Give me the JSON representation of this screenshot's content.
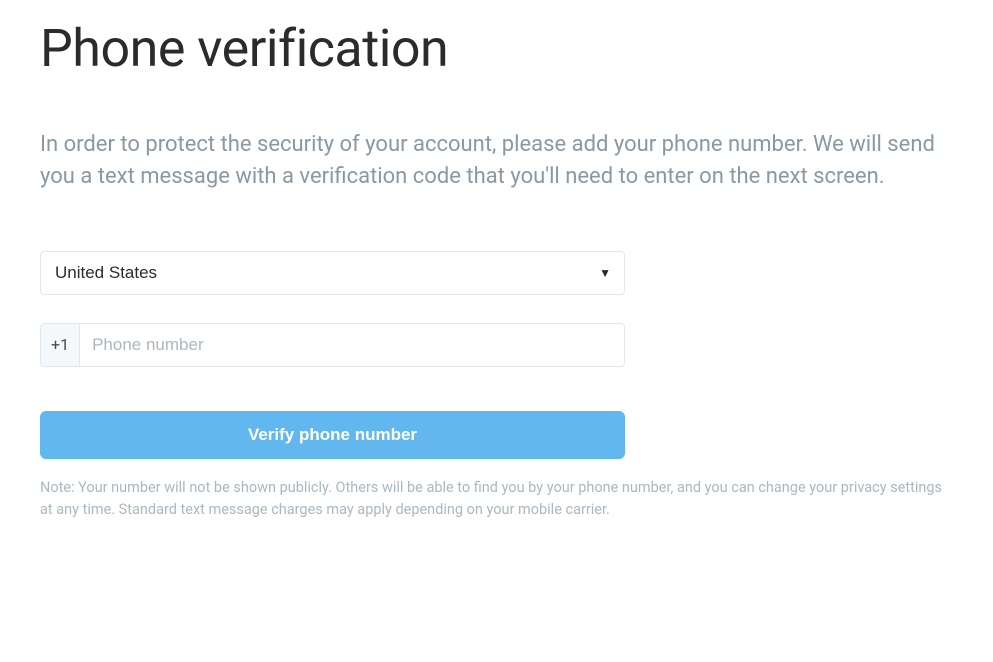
{
  "title": "Phone verification",
  "description": "In order to protect the security of your account, please add your phone number. We will send you a text message with a verification code that you'll need to enter on the next screen.",
  "form": {
    "country_selected": "United States",
    "phone_prefix": "+1",
    "phone_placeholder": "Phone number",
    "phone_value": "",
    "verify_button_label": "Verify phone number"
  },
  "note": "Note: Your number will not be shown publicly. Others will be able to find you by your phone number, and you can change your privacy settings at any time. Standard text message charges may apply depending on your mobile carrier."
}
